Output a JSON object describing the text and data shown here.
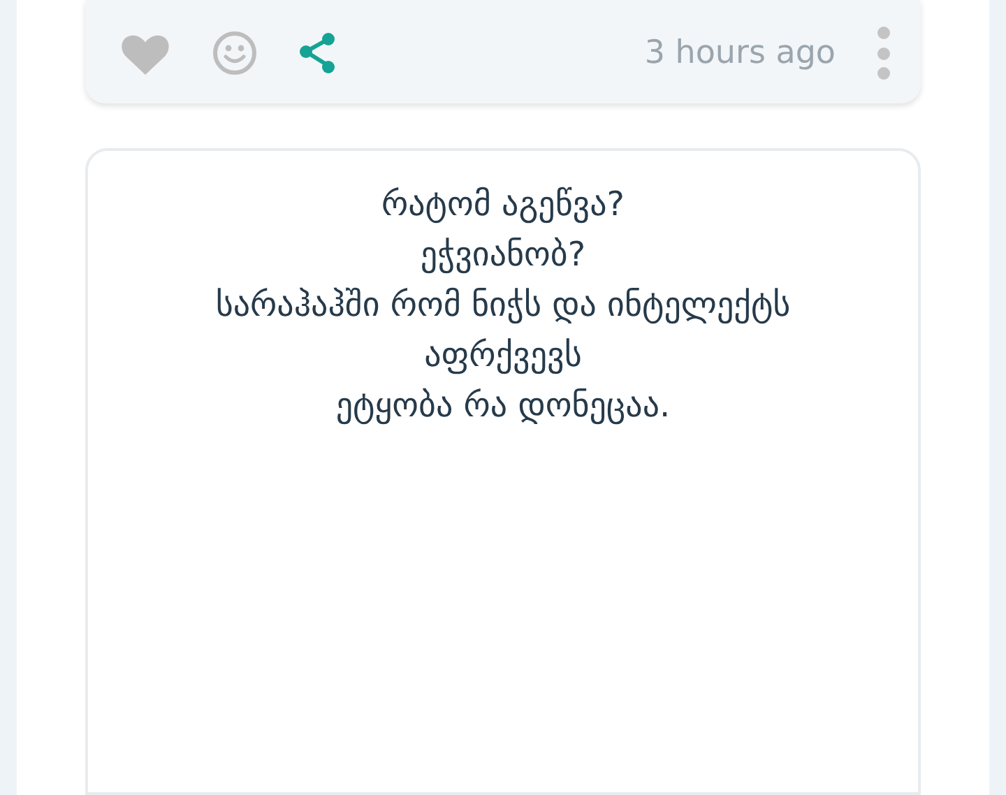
{
  "previous_post": {
    "time": "3 hours ago"
  },
  "post": {
    "text": "რატომ აგეწვა?\nეჭვიანობ?\nსარაჰაჰში რომ ნიჭს და ინტელექტს\nაფრქვევს\nეტყობა რა დონეცაა."
  }
}
